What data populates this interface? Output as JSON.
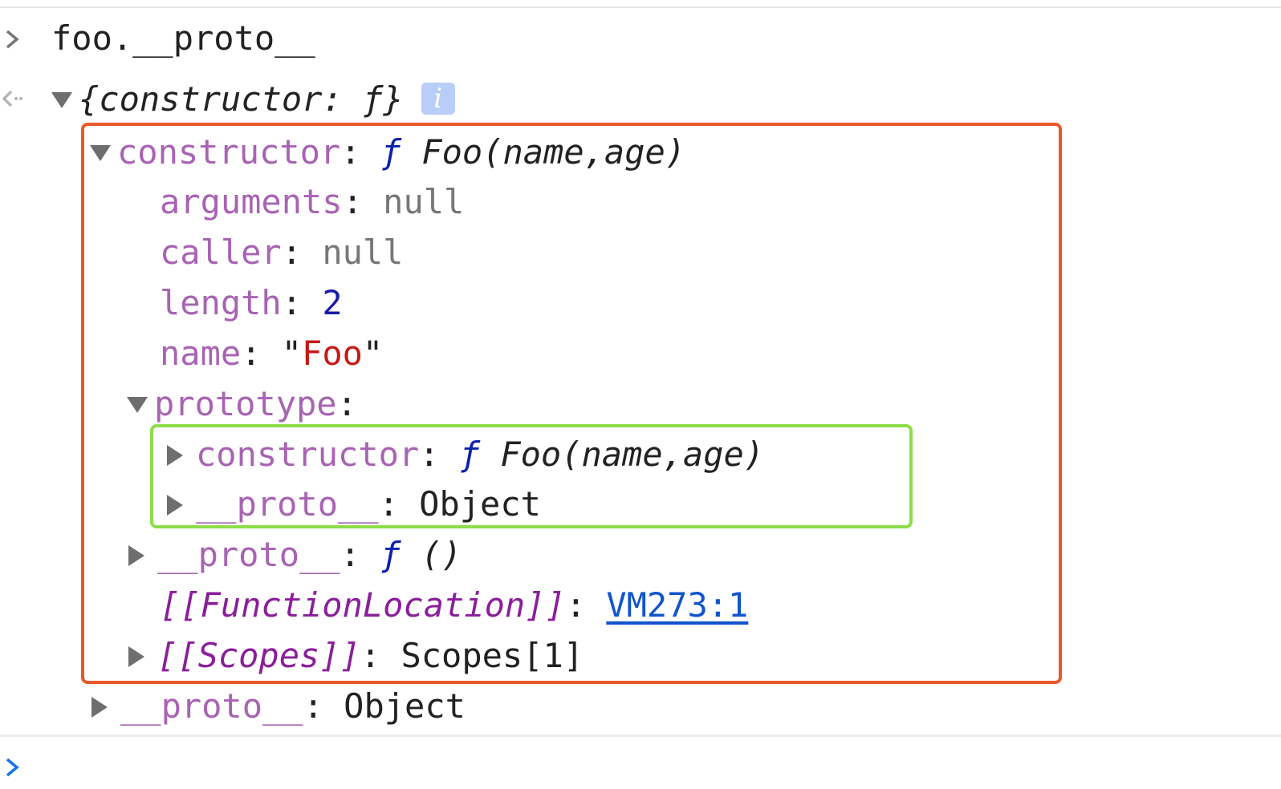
{
  "console": {
    "input": "foo.__proto__",
    "result_preview": "{constructor: ƒ}",
    "info_badge": "i",
    "rows": {
      "constructor_key": "constructor",
      "colon": ":",
      "f": "ƒ",
      "foo_sig": "Foo(name,age)",
      "arguments_key": "arguments",
      "null": "null",
      "caller_key": "caller",
      "length_key": "length",
      "length_val": "2",
      "name_key": "name",
      "quote": "\"",
      "name_val": "Foo",
      "prototype_key": "prototype",
      "proto_key": "__proto__",
      "object": "Object",
      "empty_fn": "()",
      "fnloc_key": "[[FunctionLocation]]",
      "fnloc_link": "VM273:1",
      "scopes_key": "[[Scopes]]",
      "scopes_val": "Scopes[1]"
    }
  },
  "colors": {
    "highlight_outer": "#e8582a",
    "highlight_inner": "#8cdd4a",
    "key": "#a863b3",
    "string": "#c41a16",
    "number": "#1a1aa6",
    "link": "#1155cc"
  }
}
